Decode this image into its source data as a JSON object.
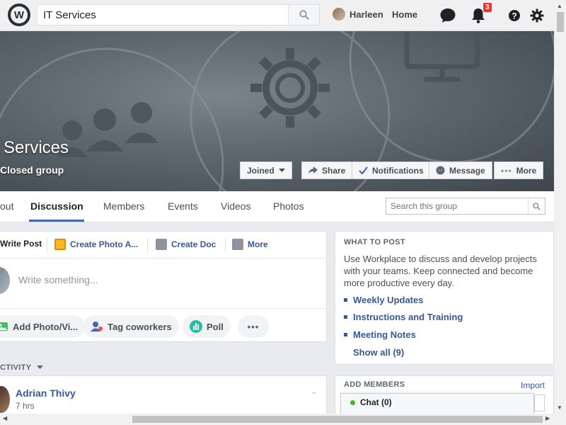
{
  "topbar": {
    "search_value": "IT Services",
    "user_name": "Harleen",
    "home_label": "Home",
    "notification_count": "3",
    "icons": [
      "workplace-logo-icon",
      "search-icon",
      "chat-bubble-icon",
      "bell-icon",
      "help-icon",
      "gear-icon"
    ]
  },
  "cover": {
    "group_name": "Services",
    "privacy": "Closed group",
    "buttons": {
      "joined": "Joined",
      "share": "Share",
      "notifications": "Notifications",
      "message": "Message",
      "more": "More"
    }
  },
  "tabs": {
    "about": "out",
    "discussion": "Discussion",
    "members": "Members",
    "events": "Events",
    "videos": "Videos",
    "photos": "Photos",
    "search_placeholder": "Search this group"
  },
  "composer": {
    "write_post": "Write Post",
    "create_photo": "Create Photo A...",
    "create_doc": "Create Doc",
    "more": "More",
    "placeholder": "Write something...",
    "add_photo": "Add Photo/Vi...",
    "tag_coworkers": "Tag coworkers",
    "poll": "Poll"
  },
  "activity": {
    "label": "CTIVITY",
    "post": {
      "author": "Adrian Thivy",
      "time": "7 hrs"
    }
  },
  "what_to_post": {
    "title": "WHAT TO POST",
    "description": "Use Workplace to discuss and develop projects with your teams. Keep connected and become more productive every day.",
    "links": [
      "Weekly Updates",
      "Instructions and Training",
      "Meeting Notes"
    ],
    "show_all": "Show all (9)"
  },
  "add_members": {
    "title": "ADD MEMBERS",
    "import": "Import"
  },
  "chat": {
    "label": "Chat (0)"
  },
  "colors": {
    "link": "#365899",
    "accent": "#4267b2",
    "badge": "#e53935",
    "online": "#42b72a"
  }
}
